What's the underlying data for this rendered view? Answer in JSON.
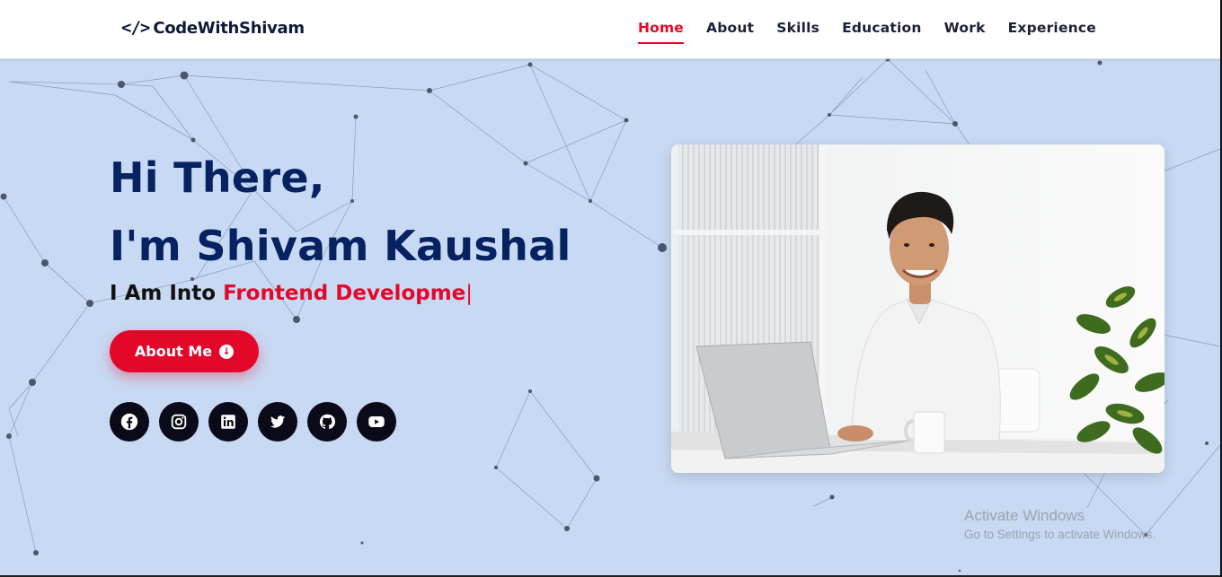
{
  "header": {
    "logo_icon": "</>",
    "logo_text": "CodeWithShivam",
    "nav": [
      {
        "label": "Home",
        "active": true
      },
      {
        "label": "About"
      },
      {
        "label": "Skills"
      },
      {
        "label": "Education"
      },
      {
        "label": "Work"
      },
      {
        "label": "Experience"
      }
    ]
  },
  "hero": {
    "greeting_line1": "Hi There,",
    "greeting_line2": "I'm Shivam Kaushal",
    "role_prefix": "I Am Into ",
    "role_typed": "Frontend Developme",
    "role_caret": "|",
    "button_label": "About Me",
    "button_icon": "arrow-down-circle-icon"
  },
  "socials": [
    {
      "name": "facebook-icon"
    },
    {
      "name": "instagram-icon"
    },
    {
      "name": "linkedin-icon"
    },
    {
      "name": "twitter-icon"
    },
    {
      "name": "github-icon"
    },
    {
      "name": "youtube-icon"
    }
  ],
  "colors": {
    "accent": "#e3082a",
    "heading": "#062260",
    "background": "#c8d9f3",
    "social_bg": "#0a0a18"
  },
  "watermark": {
    "title": "Activate Windows",
    "subtitle": "Go to Settings to activate Windows."
  }
}
